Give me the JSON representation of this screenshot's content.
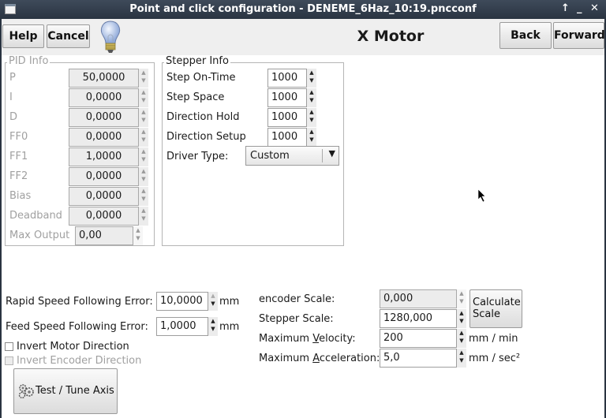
{
  "window": {
    "title": "Point and click configuration - DENEME_6Haz_10:19.pncconf",
    "controls": {
      "maximize": "↑",
      "minimize": "‗",
      "close": "✕"
    }
  },
  "header": {
    "help_label": "Help",
    "cancel_label": "Cancel",
    "hint_icon": "lightbulb-icon",
    "page_title": "X Motor",
    "back_label": "Back",
    "forward_label": "Forward"
  },
  "pid_info": {
    "title": "PID Info",
    "rows": [
      {
        "label": "P",
        "value": "50,0000"
      },
      {
        "label": "I",
        "value": "0,0000"
      },
      {
        "label": "D",
        "value": "0,0000"
      },
      {
        "label": "FF0",
        "value": "0,0000"
      },
      {
        "label": "FF1",
        "value": "1,0000"
      },
      {
        "label": "FF2",
        "value": "0,0000"
      },
      {
        "label": "Bias",
        "value": "0,0000"
      },
      {
        "label": "Deadband",
        "value": "0,0000"
      }
    ],
    "max_output": {
      "label": "Max Output",
      "value": "0,00"
    }
  },
  "stepper_info": {
    "title": "Stepper Info",
    "rows": [
      {
        "label": "Step On-Time",
        "value": "1000"
      },
      {
        "label": "Step Space",
        "value": "1000"
      },
      {
        "label": "Direction Hold",
        "value": "1000"
      },
      {
        "label": "Direction Setup",
        "value": "1000"
      }
    ],
    "driver_type": {
      "label": "Driver Type:",
      "value": "Custom"
    }
  },
  "following_error": {
    "rapid": {
      "label": "Rapid Speed Following Error:",
      "value": "10,0000",
      "unit": "mm"
    },
    "feed": {
      "label": "Feed Speed Following Error:",
      "value": "1,0000",
      "unit": "mm"
    }
  },
  "options": {
    "invert_motor": {
      "label": "Invert Motor Direction",
      "checked": false
    },
    "invert_encoder": {
      "label": "Invert Encoder Direction",
      "checked": false,
      "enabled": false
    }
  },
  "test_tune_label": "Test / Tune Axis",
  "scale": {
    "encoder": {
      "label": "encoder Scale:",
      "value": "0,000"
    },
    "stepper": {
      "label": "Stepper Scale:",
      "value": "1280,000"
    },
    "calculate_label_1": "Calculate",
    "calculate_label_2": "Scale"
  },
  "limits": {
    "velocity": {
      "label_pre": "Maximum ",
      "label_mnemonic": "V",
      "label_post": "elocity:",
      "value": "200",
      "unit": "mm / min"
    },
    "acceleration": {
      "label_pre": "Maximum ",
      "label_mnemonic": "A",
      "label_post": "cceleration:",
      "value": "5,0",
      "unit": "mm / sec²"
    }
  }
}
